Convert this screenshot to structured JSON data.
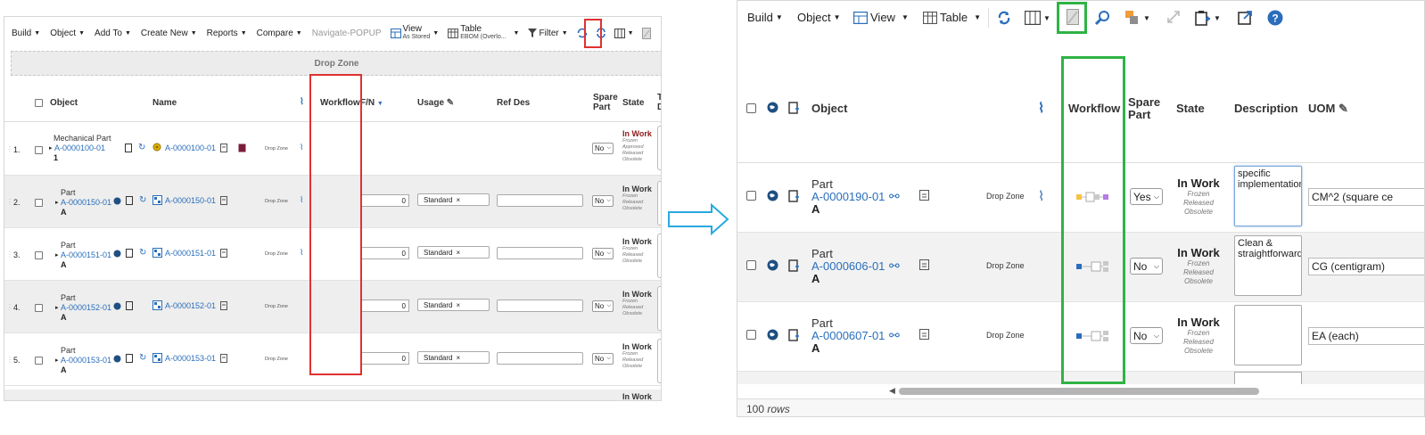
{
  "left": {
    "toolbar": {
      "build": "Build",
      "object": "Object",
      "add_to": "Add To",
      "create_new": "Create New",
      "reports": "Reports",
      "compare": "Compare",
      "navigate_popup": "Navigate-POPUP",
      "view_label": "View",
      "view_sub": "As Stored",
      "table_label": "Table",
      "table_sub": "EBOM (Overlo...",
      "filter": "Filter"
    },
    "drop_zone": "Drop Zone",
    "columns": {
      "object": "Object",
      "name": "Name",
      "workflow": "Workflow",
      "fn": "F/N",
      "usage": "Usage",
      "ref_des": "Ref Des",
      "spare_part_1": "Spare",
      "spare_part_2": "Part",
      "state": "State",
      "trunc": "T",
      "trunc2": "D"
    },
    "rows": [
      {
        "num": "1.",
        "type": "Mechanical Part",
        "id": "A-0000100-01",
        "rev": "1",
        "name": "A-0000100-01",
        "dz": "Drop Zone",
        "fn": "",
        "usage": "",
        "spare": "No",
        "state": "In Work",
        "states": [
          "Frozen",
          "Approved",
          "Released",
          "Obsolete"
        ]
      },
      {
        "num": "2.",
        "type": "Part",
        "id": "A-0000150-01",
        "rev": "A",
        "name": "A-0000150-01",
        "dz": "Drop Zone",
        "fn": "0",
        "usage": "Standard",
        "spare": "No",
        "state": "In Work",
        "states": [
          "Frozen",
          "Released",
          "Obsolete"
        ]
      },
      {
        "num": "3.",
        "type": "Part",
        "id": "A-0000151-01",
        "rev": "A",
        "name": "A-0000151-01",
        "dz": "Drop Zone",
        "fn": "0",
        "usage": "Standard",
        "spare": "No",
        "state": "In Work",
        "states": [
          "Frozen",
          "Released",
          "Obsolete"
        ]
      },
      {
        "num": "4.",
        "type": "Part",
        "id": "A-0000152-01",
        "rev": "A",
        "name": "A-0000152-01",
        "dz": "Drop Zone",
        "fn": "0",
        "usage": "Standard",
        "spare": "No",
        "state": "In Work",
        "states": [
          "Frozen",
          "Released",
          "Obsolete"
        ]
      },
      {
        "num": "5.",
        "type": "Part",
        "id": "A-0000153-01",
        "rev": "A",
        "name": "A-0000153-01",
        "dz": "Drop Zone",
        "fn": "0",
        "usage": "Standard",
        "spare": "No",
        "state": "In Work",
        "states": [
          "Frozen",
          "Released",
          "Obsolete"
        ]
      }
    ],
    "partial_row_state": "In Work"
  },
  "right": {
    "toolbar": {
      "build": "Build",
      "object": "Object",
      "view": "View",
      "table": "Table"
    },
    "columns": {
      "object": "Object",
      "workflow": "Workflow",
      "spare_part_1": "Spare",
      "spare_part_2": "Part",
      "state": "State",
      "description": "Description",
      "uom": "UOM"
    },
    "rows": [
      {
        "type": "Part",
        "id": "A-0000190-01",
        "rev": "A",
        "dz": "Drop Zone",
        "spare": "Yes",
        "state": "In Work",
        "states": [
          "Frozen",
          "Released",
          "Obsolete"
        ],
        "description": "specific implementation",
        "uom": "CM^2 (square ce"
      },
      {
        "type": "Part",
        "id": "A-0000606-01",
        "rev": "A",
        "dz": "Drop Zone",
        "spare": "No",
        "state": "In Work",
        "states": [
          "Frozen",
          "Released",
          "Obsolete"
        ],
        "description": "Clean & straightforward",
        "uom": "CG (centigram)"
      },
      {
        "type": "Part",
        "id": "A-0000607-01",
        "rev": "A",
        "dz": "Drop Zone",
        "spare": "No",
        "state": "In Work",
        "states": [
          "Frozen",
          "Released",
          "Obsolete"
        ],
        "description": "",
        "uom": "EA (each)"
      }
    ],
    "footer": {
      "count": "100",
      "rows_label": "rows"
    }
  },
  "colors": {
    "red_highlight": "#e03131",
    "green_highlight": "#2fb344",
    "arrow": "#29a9e0",
    "link": "#2a6ebb",
    "in_work_dark_red": "#8b1a1a"
  }
}
